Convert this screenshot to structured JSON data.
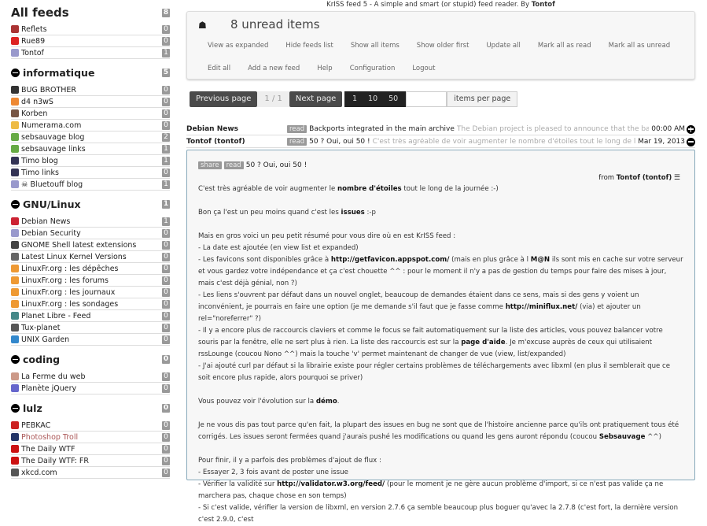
{
  "header": {
    "pre": "KrISS feed 5 - A simple and smart (or stupid) feed reader. By ",
    "author": "Tontof"
  },
  "menu": {
    "unread": "8 unread items",
    "row1": [
      "View as expanded",
      "Hide feeds list",
      "Show all items",
      "Show older first",
      "Update all",
      "Mark all as read",
      "Mark all as unread"
    ],
    "row2": [
      "Edit all",
      "Add a new feed",
      "Help",
      "Configuration",
      "Logout"
    ]
  },
  "pager": {
    "prev": "Previous page",
    "current": "1 / 1",
    "next": "Next page",
    "ipp": [
      "1",
      "10",
      "50"
    ],
    "ipp_value": "",
    "ipp_label": "items per page"
  },
  "sidebar": {
    "all": {
      "label": "All feeds",
      "count": "8"
    },
    "top": [
      {
        "name": "Reflets",
        "count": "0",
        "color": "#a33"
      },
      {
        "name": "Rue89",
        "count": "0",
        "color": "#d22"
      },
      {
        "name": "Tontof",
        "count": "1",
        "color": "#99c"
      }
    ],
    "groups": [
      {
        "label": "informatique",
        "count": "5",
        "feeds": [
          {
            "name": "BUG BROTHER",
            "count": "0",
            "color": "#333"
          },
          {
            "name": "d4 n3wS",
            "count": "0",
            "color": "#e83"
          },
          {
            "name": "Korben",
            "count": "0",
            "color": "#754"
          },
          {
            "name": "Numerama.com",
            "count": "0",
            "color": "#eb4"
          },
          {
            "name": "sebsauvage blog",
            "count": "2",
            "color": "#6a4"
          },
          {
            "name": "sebsauvage links",
            "count": "1",
            "color": "#6a4"
          },
          {
            "name": "Timo blog",
            "count": "1",
            "color": "#335"
          },
          {
            "name": "Timo links",
            "count": "0",
            "color": "#335"
          },
          {
            "name": "☠ Bluetouff blog",
            "count": "1",
            "color": "#99c"
          }
        ]
      },
      {
        "label": "GNU/Linux",
        "count": "1",
        "feeds": [
          {
            "name": "Debian News",
            "count": "1",
            "color": "#c23"
          },
          {
            "name": "Debian Security",
            "count": "0",
            "color": "#99c"
          },
          {
            "name": "GNOME Shell latest extensions",
            "count": "0",
            "color": "#444"
          },
          {
            "name": "Latest Linux Kernel Versions",
            "count": "0",
            "color": "#666"
          },
          {
            "name": "LinuxFr.org : les dépêches",
            "count": "0",
            "color": "#e93"
          },
          {
            "name": "LinuxFr.org : les forums",
            "count": "0",
            "color": "#e93"
          },
          {
            "name": "LinuxFr.org : les journaux",
            "count": "0",
            "color": "#e93"
          },
          {
            "name": "LinuxFr.org : les sondages",
            "count": "0",
            "color": "#e93"
          },
          {
            "name": "Planet Libre - Feed",
            "count": "0",
            "color": "#488"
          },
          {
            "name": "Tux-planet",
            "count": "0",
            "color": "#555"
          },
          {
            "name": "UNIX Garden",
            "count": "0",
            "color": "#38c"
          }
        ]
      },
      {
        "label": "coding",
        "count": "0",
        "feeds": [
          {
            "name": "La Ferme du web",
            "count": "0",
            "color": "#c98"
          },
          {
            "name": "Planète jQuery",
            "count": "0",
            "color": "#66c"
          }
        ]
      },
      {
        "label": "lulz",
        "count": "0",
        "feeds": [
          {
            "name": "PEBKAC",
            "count": "0",
            "color": "#c22"
          },
          {
            "name": "Photoshop Troll",
            "count": "0",
            "color": "#236",
            "error": true
          },
          {
            "name": "The Daily WTF",
            "count": "0",
            "color": "#c11"
          },
          {
            "name": "The Daily WTF: FR",
            "count": "0",
            "color": "#c11"
          },
          {
            "name": "xkcd.com",
            "count": "0",
            "color": "#555"
          }
        ]
      }
    ]
  },
  "items": [
    {
      "source": "Debian News",
      "tag": "read",
      "title": "Backports integrated in the main archive",
      "excerpt": "The Debian project is pleased to announce that the backports servic...",
      "date": "00:00 AM"
    },
    {
      "source": "Tontof (tontof)",
      "tag": "read",
      "title": "50 ? Oui, oui 50 !",
      "excerpt": "C'est très agréable de voir augmenter le nombre d'étoiles tout le long de la journée :-) Bo...",
      "date": "Mar 19, 2013"
    }
  ],
  "article": {
    "share": "share",
    "read": "read",
    "title": "50 ? Oui, oui 50 !",
    "from": "from ",
    "from_name": "Tontof (tontof)",
    "paragraphs": [
      [
        [
          "C'est très agréable de voir augmenter le ",
          0
        ],
        [
          "nombre d'étoiles",
          1
        ],
        [
          " tout le long de la journée :-)",
          0
        ]
      ],
      [],
      [
        [
          "Bon ça l'est un peu moins quand c'est les ",
          0
        ],
        [
          "issues",
          1
        ],
        [
          " :-p",
          0
        ]
      ],
      [],
      [
        [
          "Mais en gros voici un peu petit résumé pour vous dire où en est KrISS feed :",
          0
        ]
      ],
      [
        [
          "- La date est ajoutée (en view list et expanded)",
          0
        ]
      ],
      [
        [
          "- Les favicons sont disponibles grâce à ",
          0
        ],
        [
          "http://getfavicon.appspot.com/",
          1
        ],
        [
          " (mais en plus grâce à l ",
          0
        ],
        [
          "M@N",
          1
        ],
        [
          " ils sont mis en cache sur votre serveur et vous gardez votre indépendance et ça c'est chouette ^^ : pour le moment il n'y a pas de gestion du temps pour faire des mises à jour, mais c'est déjà génial, non ?)",
          0
        ]
      ],
      [
        [
          "- Les liens s'ouvrent par défaut dans un nouvel onglet, beaucoup de demandes étaient dans ce sens, mais si des gens y voient un inconvénient, je pourrais en faire une option (je me demande s'il faut que je fasse comme ",
          0
        ],
        [
          "http://miniflux.net/",
          1
        ],
        [
          " (via) et ajouter un rel=\"noreferrer\" ?)",
          0
        ]
      ],
      [
        [
          "- Il y a encore plus de raccourcis claviers et comme le focus se fait automatiquement sur la liste des articles, vous pouvez balancer votre souris par la fenêtre, elle ne sert plus à rien. La liste des raccourcis est sur la ",
          0
        ],
        [
          "page d'aide",
          1
        ],
        [
          ". Je m'excuse auprès de ceux qui utilisaient rssLounge (coucou Nono ^^) mais la touche 'v' permet maintenant de changer de vue (view, list/expanded)",
          0
        ]
      ],
      [
        [
          "- J'ai ajouté curl par défaut si la librairie existe pour régler certains problèmes de téléchargements avec libxml (en plus il semblerait que ce soit encore plus rapide, alors pourquoi se priver)",
          0
        ]
      ],
      [],
      [
        [
          "Vous pouvez voir l'évolution sur la ",
          0
        ],
        [
          "démo",
          1
        ],
        [
          ".",
          0
        ]
      ],
      [],
      [
        [
          "Je ne vous dis pas tout parce qu'en fait, la plupart des issues en bug ne sont que de l'histoire ancienne parce qu'ils ont pratiquement tous été corrigés. Les issues seront fermées quand j'aurais pushé les modifications ou quand les gens auront répondu (coucou ",
          0
        ],
        [
          "Sebsauvage",
          1
        ],
        [
          " ^^)",
          0
        ]
      ],
      [],
      [
        [
          "Pour finir, il y a parfois des problèmes d'ajout de flux :",
          0
        ]
      ],
      [
        [
          "- Essayer 2, 3 fois avant de poster une issue",
          0
        ]
      ],
      [
        [
          "- Vérifier la validité sur ",
          0
        ],
        [
          "http://validator.w3.org/feed/",
          1
        ],
        [
          " (pour le moment je ne gère aucun problème d'import, si ce n'est pas valide ça ne marchera pas, chaque chose en son temps)",
          0
        ]
      ],
      [
        [
          "- Si c'est valide, vérifier la version de libxml, en version 2.7.6 ça semble beaucoup plus boguer qu'avec la 2.7.8 (c'est fort, la dernière version c'est 2.9.0, c'est",
          0
        ]
      ]
    ]
  }
}
